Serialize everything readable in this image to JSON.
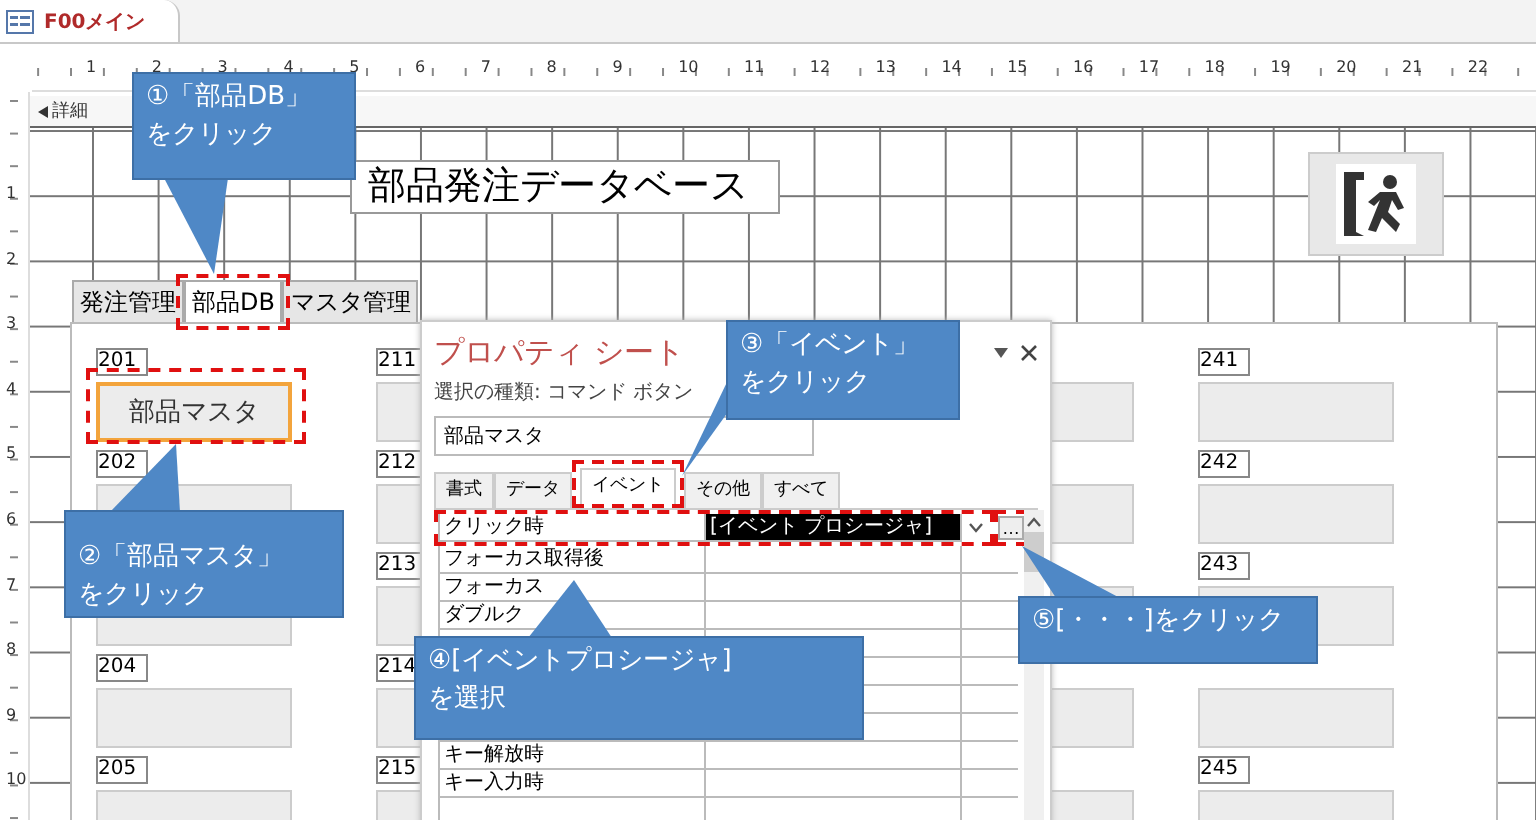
{
  "document_tab": {
    "title": "F00メイン"
  },
  "ruler": {
    "top_marks": [
      "1",
      "2",
      "3",
      "4",
      "5",
      "6",
      "7",
      "8",
      "9",
      "10",
      "11",
      "12",
      "13",
      "14",
      "15",
      "16",
      "17",
      "18",
      "19",
      "20",
      "21",
      "22"
    ],
    "left_marks": [
      "1",
      "2",
      "3",
      "4",
      "5",
      "6",
      "7",
      "8",
      "9",
      "10"
    ]
  },
  "section": {
    "title": "詳細"
  },
  "form": {
    "title_label": "部品発注データベース"
  },
  "tab_control": {
    "tabs": [
      {
        "label": "発注管理",
        "selected": false
      },
      {
        "label": "部品DB",
        "selected": true
      },
      {
        "label": "マスタ管理",
        "selected": false
      }
    ],
    "columns": [
      {
        "slots": [
          {
            "number": "201",
            "caption": "部品マスタ",
            "selected": true
          },
          {
            "number": "202",
            "selected": false
          },
          {
            "selected": false
          },
          {
            "number": "204",
            "selected": false
          },
          {
            "number": "205",
            "selected": false
          }
        ]
      },
      {
        "slots": [
          {
            "number": "211",
            "selected": false
          },
          {
            "number": "212",
            "selected": false
          },
          {
            "number": "213",
            "selected": false
          },
          {
            "number": "214",
            "selected": false
          },
          {
            "number": "215",
            "selected": false
          }
        ]
      },
      {
        "slots": [
          {
            "selected": false
          },
          {
            "selected": false
          },
          {
            "selected": false
          },
          {
            "selected": false
          },
          {
            "selected": false
          }
        ]
      },
      {
        "slots": [
          {
            "number": "241",
            "selected": false
          },
          {
            "number": "242",
            "selected": false
          },
          {
            "number": "243",
            "selected": false
          },
          {
            "selected": false
          },
          {
            "number": "245",
            "selected": false
          }
        ]
      }
    ]
  },
  "property_sheet": {
    "title": "プロパティ シート",
    "selection_type": "選択の種類: コマンド ボタン",
    "object": "部品マスタ",
    "tabs": [
      {
        "label": "書式",
        "selected": false
      },
      {
        "label": "データ",
        "selected": false
      },
      {
        "label": "イベント",
        "selected": true
      },
      {
        "label": "その他",
        "selected": false
      },
      {
        "label": "すべて",
        "selected": false
      }
    ],
    "rows": [
      {
        "name": "クリック時",
        "value": "[イベント プロシージャ]",
        "selected": true
      },
      {
        "name": "フォーカス取得後",
        "selected": false
      },
      {
        "name": "フォーカス",
        "selected": false
      },
      {
        "name": "ダブルク",
        "selected": false
      }
    ],
    "more_rows": [
      {
        "name": "キー解放時",
        "selected": false
      },
      {
        "name": "キー入力時",
        "selected": false
      }
    ],
    "builder_button": "…"
  },
  "callouts": [
    {
      "lines": [
        "①「部品DB」",
        "をクリック"
      ]
    },
    {
      "lines": [
        "②「部品マスタ」",
        "をクリック"
      ]
    },
    {
      "lines": [
        "③「イベント」",
        "をクリック"
      ]
    },
    {
      "lines": [
        "④[イベントプロシージャ]",
        "を選択"
      ]
    },
    {
      "lines": [
        "⑤[・・・]をクリック"
      ]
    }
  ]
}
